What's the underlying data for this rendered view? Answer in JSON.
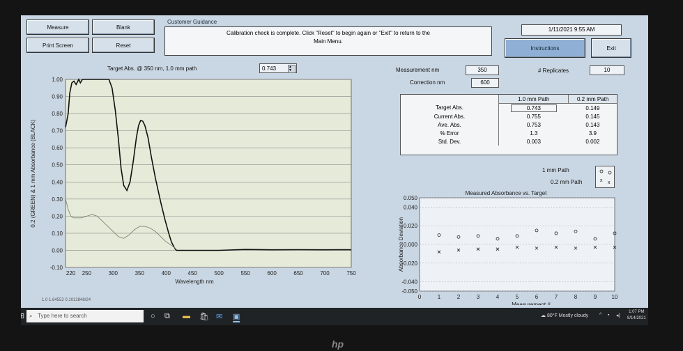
{
  "toolbar": {
    "measure": "Measure",
    "blank": "Blank",
    "print_screen": "Print Screen",
    "reset": "Reset",
    "instructions": "Instructions",
    "exit": "Exit"
  },
  "guidance": {
    "title": "Customer Guidance",
    "line1": "Calibration check is complete.  Click \"Reset\" to begin again or \"Exit\" to return to the",
    "line2": "Main Menu."
  },
  "datetime": "1/11/2021  9:55 AM",
  "target": {
    "label": "Target Abs. @ 350 nm, 1.0 mm path",
    "value": "0.743"
  },
  "measurement": {
    "measurement_label": "Measurement nm",
    "measurement_value": "350",
    "correction_label": "Correction nm",
    "correction_value": "600",
    "replicates_label": "# Replicates",
    "replicates_value": "10"
  },
  "stats": {
    "headers": [
      "",
      "1.0 mm Path",
      "0.2 mm Path"
    ],
    "rows": [
      [
        "Target Abs.",
        "0.743",
        "0.149"
      ],
      [
        "Current Abs.",
        "0.755",
        "0.145"
      ],
      [
        "Ave. Abs.",
        "0.753",
        "0.143"
      ],
      [
        "% Error",
        "1.3",
        "3.9"
      ],
      [
        "Std. Dev.",
        "0.003",
        "0.002"
      ]
    ]
  },
  "legend": {
    "one_mm": "1 mm Path",
    "point_two_mm": "0.2 mm Path"
  },
  "status_text": "1.0 1.64552  0.1012848/24",
  "taskbar": {
    "search_placeholder": "Type here to search",
    "weather": "80°F  Mostly cloudy",
    "time": "1:07 PM",
    "date": "8/14/2021"
  },
  "bezel": {
    "logo": "hp"
  },
  "chart_data": [
    {
      "type": "line",
      "title": "",
      "xlabel": "Wavelength nm",
      "ylabel": "0.2 (GREEN) & 1 mm Absorbance (BLACK)",
      "xlim": [
        210,
        750
      ],
      "ylim": [
        -0.1,
        1.0
      ],
      "xticks": [
        220,
        250,
        300,
        350,
        400,
        450,
        500,
        550,
        600,
        650,
        700,
        750
      ],
      "yticks": [
        "-0.10",
        "0.00",
        "0.10",
        "0.20",
        "0.30",
        "0.40",
        "0.50",
        "0.60",
        "0.70",
        "0.80",
        "0.90",
        "1.00"
      ],
      "series": [
        {
          "color": "#111111",
          "x": [
            210,
            212,
            215,
            218,
            222,
            226,
            230,
            235,
            238,
            242,
            248,
            255,
            262,
            270,
            278,
            285,
            292,
            298,
            304,
            310,
            315,
            320,
            326,
            332,
            338,
            344,
            348,
            352,
            356,
            360,
            366,
            372,
            380,
            390,
            398,
            405,
            410,
            415,
            418,
            420,
            450,
            500,
            550,
            600,
            650,
            700,
            740,
            750
          ],
          "y": [
            0.72,
            0.75,
            0.8,
            0.92,
            0.98,
            0.99,
            0.97,
            1.0,
            0.98,
            1.0,
            1.0,
            1.0,
            1.0,
            1.0,
            1.0,
            1.0,
            1.0,
            0.95,
            0.82,
            0.65,
            0.48,
            0.38,
            0.35,
            0.4,
            0.52,
            0.66,
            0.73,
            0.76,
            0.755,
            0.73,
            0.66,
            0.55,
            0.42,
            0.28,
            0.18,
            0.1,
            0.05,
            0.02,
            0.005,
            0.0,
            0.0,
            0.0,
            0.005,
            0.003,
            0.004,
            0.003,
            0.004,
            0.003
          ]
        },
        {
          "color": "#7a8a72",
          "x": [
            210,
            215,
            220,
            225,
            230,
            240,
            250,
            260,
            270,
            280,
            290,
            300,
            310,
            320,
            330,
            340,
            350,
            360,
            370,
            380,
            390,
            400,
            410,
            420
          ],
          "y": [
            0.3,
            0.24,
            0.2,
            0.19,
            0.19,
            0.19,
            0.2,
            0.21,
            0.2,
            0.17,
            0.14,
            0.11,
            0.08,
            0.07,
            0.09,
            0.12,
            0.14,
            0.14,
            0.13,
            0.11,
            0.08,
            0.05,
            0.03,
            0.005
          ]
        }
      ]
    },
    {
      "type": "scatter",
      "title": "Measured Absorbance vs. Target",
      "xlabel": "Measurement #",
      "ylabel": "Absorbance Deviation",
      "xlim": [
        0,
        10
      ],
      "ylim": [
        -0.05,
        0.05
      ],
      "xticks": [
        0,
        1,
        2,
        3,
        4,
        5,
        6,
        7,
        8,
        9,
        10
      ],
      "yticks": [
        [
          "-0.050",
          -0.05
        ],
        [
          "-0.040",
          -0.04
        ],
        [
          "-0.020",
          -0.02
        ],
        [
          "0.000",
          0.0
        ],
        [
          "0.020",
          0.02
        ],
        [
          "0.040",
          0.04
        ],
        [
          "0.050",
          0.05
        ]
      ],
      "series": [
        {
          "marker": "o",
          "x": [
            1,
            2,
            3,
            4,
            5,
            6,
            7,
            8,
            9,
            10
          ],
          "y": [
            0.01,
            0.008,
            0.009,
            0.006,
            0.009,
            0.015,
            0.012,
            0.014,
            0.006,
            0.012
          ]
        },
        {
          "marker": "x",
          "x": [
            1,
            2,
            3,
            4,
            5,
            6,
            7,
            8,
            9,
            10
          ],
          "y": [
            -0.008,
            -0.006,
            -0.005,
            -0.005,
            -0.003,
            -0.004,
            -0.003,
            -0.004,
            -0.003,
            -0.003
          ]
        }
      ]
    }
  ]
}
